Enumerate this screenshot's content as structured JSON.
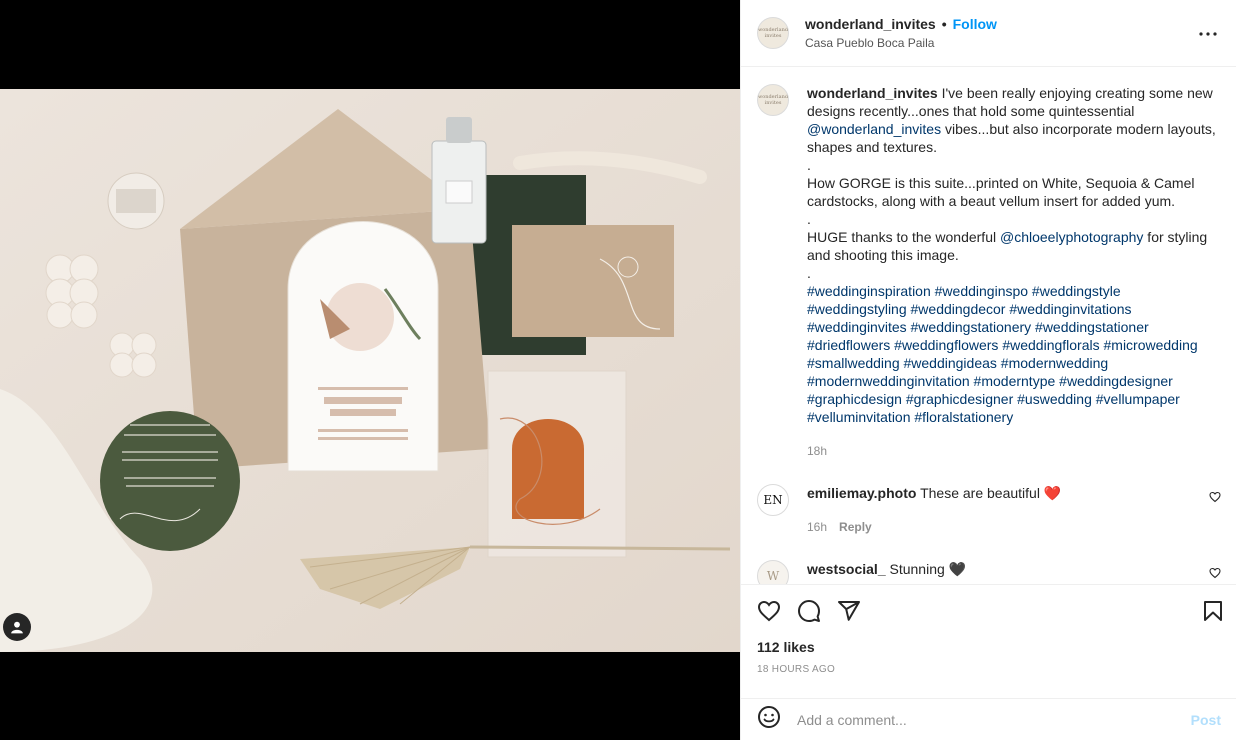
{
  "post": {
    "username": "wonderland_invites",
    "follow_label": "Follow",
    "location": "Casa Pueblo Boca Paila",
    "avatar_text": "wonderland invites"
  },
  "caption": {
    "username": "wonderland_invites",
    "text1": " I've been really enjoying creating some new designs recently...ones that hold some quintessential ",
    "mention1": "@wonderland_invites",
    "text2": " vibes...but also incorporate modern layouts, shapes and textures.",
    "sep1": ".",
    "text3": "How GORGE is this suite...printed on White, Sequoia & Camel cardstocks, along with a beaut vellum insert for added yum.",
    "sep2": ".",
    "text4": "HUGE thanks to the wonderful ",
    "mention2": "@chloeelyphotography",
    "text5": " for styling and shooting this image.",
    "sep3": ".",
    "hashtags": "#weddinginspiration #weddinginspo #weddingstyle #weddingstyling #weddingdecor #weddinginvitations #weddinginvites #weddingstationery #weddingstationer #driedflowers #weddingflowers #weddingflorals #microwedding #smallwedding #weddingideas #modernwedding #modernweddinginvitation #moderntype #weddingdesigner #graphicdesign #graphicdesigner #uswedding #vellumpaper #velluminvitation #floralstationery",
    "age": "18h"
  },
  "comments": [
    {
      "username": "emiliemay.photo",
      "text": "These are beautiful ❤️",
      "age": "16h",
      "reply_label": "Reply",
      "avatar_text": "EN"
    },
    {
      "username": "westsocial_",
      "text": "Stunning 🖤",
      "avatar_text": "W"
    }
  ],
  "stats": {
    "likes": "112 likes",
    "time": "18 HOURS AGO"
  },
  "composer": {
    "placeholder": "Add a comment...",
    "post_label": "Post"
  },
  "colors": {
    "accent": "#0095f6",
    "link": "#00376b",
    "post_disabled": "#b2dffc"
  }
}
